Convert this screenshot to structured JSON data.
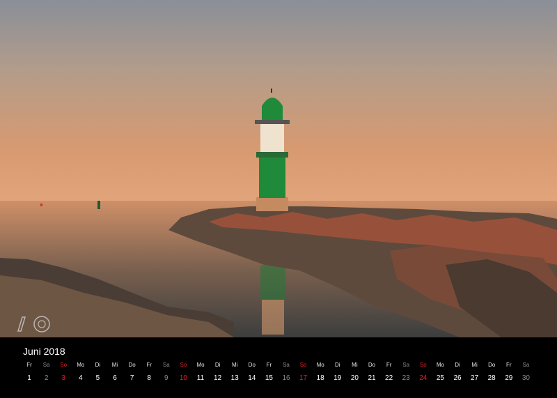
{
  "calendar": {
    "month": "Juni",
    "year": "2018",
    "days": [
      {
        "wd": "Fr",
        "d": "1"
      },
      {
        "wd": "Sa",
        "d": "2"
      },
      {
        "wd": "So",
        "d": "3"
      },
      {
        "wd": "Mo",
        "d": "4"
      },
      {
        "wd": "Di",
        "d": "5"
      },
      {
        "wd": "Mi",
        "d": "6"
      },
      {
        "wd": "Do",
        "d": "7"
      },
      {
        "wd": "Fr",
        "d": "8"
      },
      {
        "wd": "Sa",
        "d": "9"
      },
      {
        "wd": "So",
        "d": "10"
      },
      {
        "wd": "Mo",
        "d": "11"
      },
      {
        "wd": "Di",
        "d": "12"
      },
      {
        "wd": "Mi",
        "d": "13"
      },
      {
        "wd": "Do",
        "d": "14"
      },
      {
        "wd": "Fr",
        "d": "15"
      },
      {
        "wd": "Sa",
        "d": "16"
      },
      {
        "wd": "So",
        "d": "17"
      },
      {
        "wd": "Mo",
        "d": "18"
      },
      {
        "wd": "Di",
        "d": "19"
      },
      {
        "wd": "Mi",
        "d": "20"
      },
      {
        "wd": "Do",
        "d": "21"
      },
      {
        "wd": "Fr",
        "d": "22"
      },
      {
        "wd": "Sa",
        "d": "23"
      },
      {
        "wd": "So",
        "d": "24"
      },
      {
        "wd": "Mo",
        "d": "25"
      },
      {
        "wd": "Di",
        "d": "26"
      },
      {
        "wd": "Mi",
        "d": "27"
      },
      {
        "wd": "Do",
        "d": "28"
      },
      {
        "wd": "Fr",
        "d": "29"
      },
      {
        "wd": "Sa",
        "d": "30"
      }
    ]
  },
  "colors": {
    "sunday": "#e0202a",
    "saturday": "#8c8c8c",
    "strip_background": "#000000",
    "lighthouse_green": "#1f8a3a"
  },
  "icons": {
    "logo": "photographer-logo-icon"
  }
}
